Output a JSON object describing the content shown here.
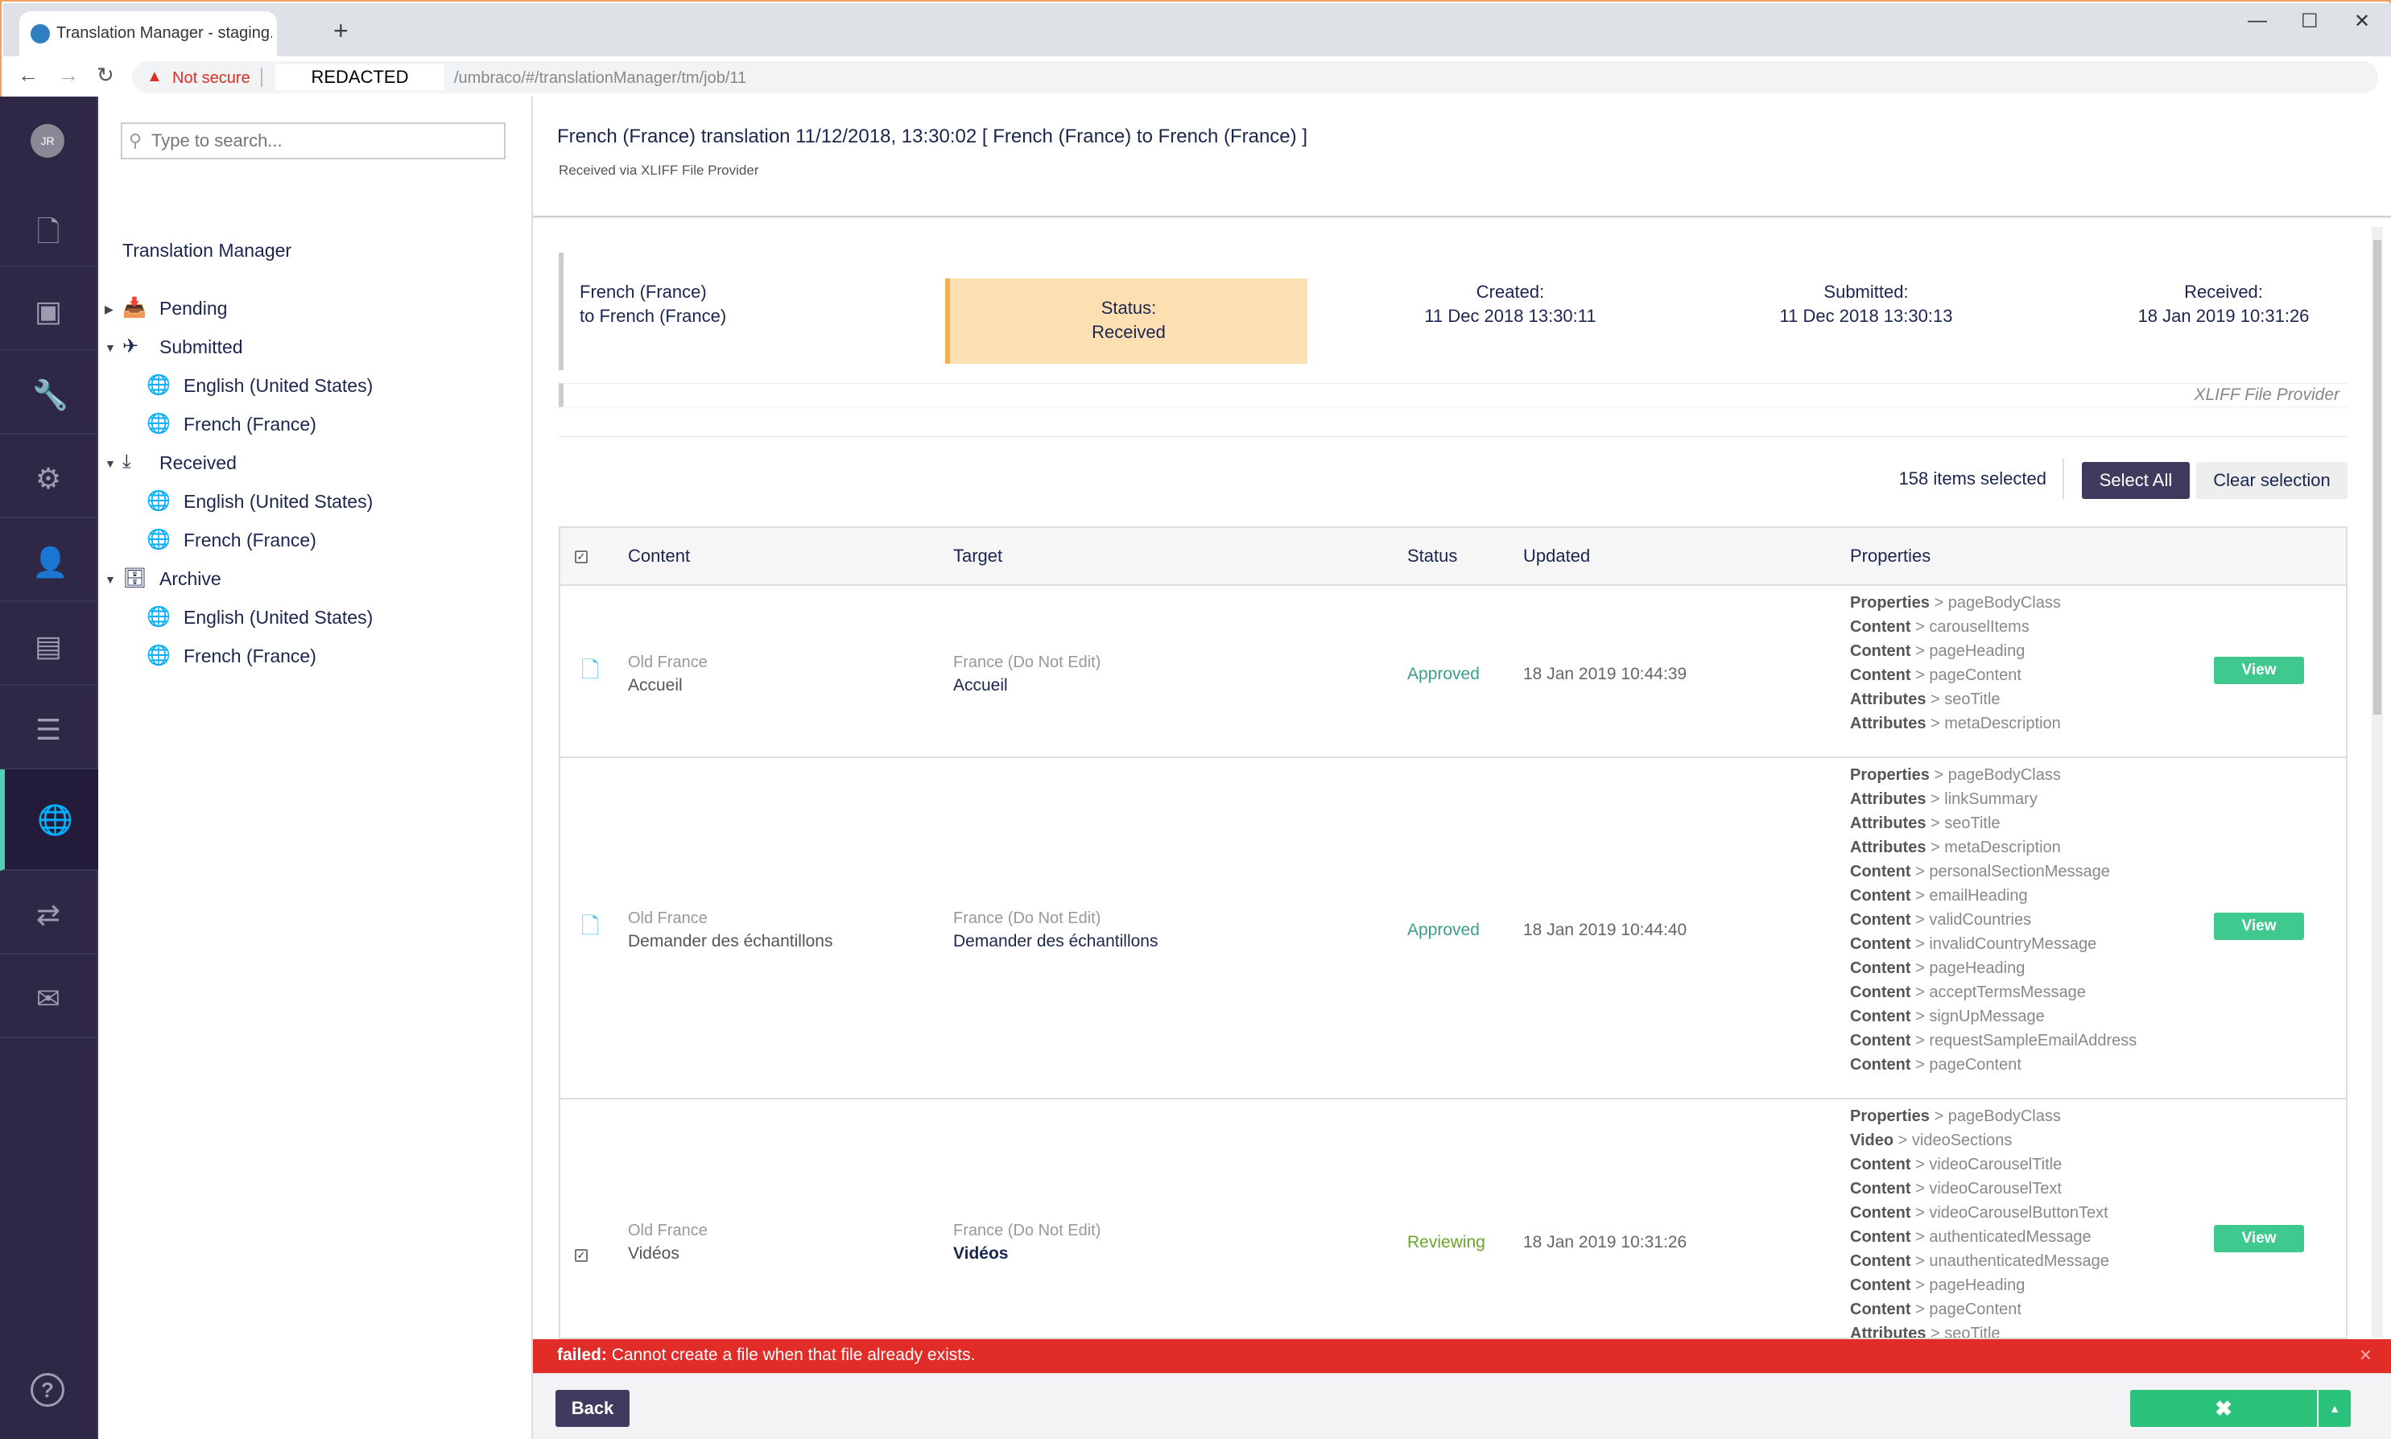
{
  "browser": {
    "tab_title": "Translation Manager - staging.ge",
    "new_tab": "+",
    "tab_close": "×",
    "minimize": "—",
    "maximize": "☐",
    "close": "✕",
    "not_secure": "Not secure",
    "redacted": "REDACTED",
    "url_path": "/umbraco/#/translationManager/tm/job/11"
  },
  "sidebar": {
    "avatar": "JR",
    "items": [
      "content-icon",
      "media-icon",
      "settings-wrench-icon",
      "settings-gear-icon",
      "members-icon",
      "forms-icon",
      "deploy-icon",
      "translation-globe-icon",
      "redirects-icon",
      "email-icon"
    ],
    "help": "?"
  },
  "tree": {
    "search_placeholder": "Type to search...",
    "title": "Translation Manager",
    "nodes": [
      {
        "label": "Pending"
      },
      {
        "label": "Submitted"
      },
      {
        "label": "English (United States)"
      },
      {
        "label": "French (France)"
      },
      {
        "label": "Received"
      },
      {
        "label": "English (United States)"
      },
      {
        "label": "French (France)"
      },
      {
        "label": "Archive"
      },
      {
        "label": "English (United States)"
      },
      {
        "label": "French (France)"
      }
    ]
  },
  "header": {
    "title": "French (France) translation 11/12/2018, 13:30:02 [ French (France) to French (France) ]",
    "subtitle": "Received via XLIFF File Provider"
  },
  "summary": {
    "from": "French (France)",
    "to_prefix": "to",
    "to": "French (France)",
    "status_label": "Status:",
    "status_value": "Received",
    "created_label": "Created:",
    "created_value": "11 Dec 2018 13:30:11",
    "submitted_label": "Submitted:",
    "submitted_value": "11 Dec 2018 13:30:13",
    "received_label": "Received:",
    "received_value": "18 Jan 2019 10:31:26",
    "provider": "XLIFF File Provider"
  },
  "selection": {
    "count_text": "158 items selected",
    "select_all": "Select All",
    "clear": "Clear selection"
  },
  "table": {
    "headers": {
      "content": "Content",
      "target": "Target",
      "status": "Status",
      "updated": "Updated",
      "properties": "Properties"
    },
    "view_label": "View",
    "rows": [
      {
        "source_site": "Old France",
        "source_name": "Accueil",
        "target_site": "France (Do Not Edit)",
        "target_name": "Accueil",
        "status": "Approved",
        "updated": "18 Jan 2019 10:44:39",
        "props": [
          [
            "Properties",
            "pageBodyClass"
          ],
          [
            "Content",
            "carouselItems"
          ],
          [
            "Content",
            "pageHeading"
          ],
          [
            "Content",
            "pageContent"
          ],
          [
            "Attributes",
            "seoTitle"
          ],
          [
            "Attributes",
            "metaDescription"
          ]
        ]
      },
      {
        "source_site": "Old France",
        "source_name": "Demander des échantillons",
        "target_site": "France (Do Not Edit)",
        "target_name": "Demander des échantillons",
        "status": "Approved",
        "updated": "18 Jan 2019 10:44:40",
        "props": [
          [
            "Properties",
            "pageBodyClass"
          ],
          [
            "Attributes",
            "linkSummary"
          ],
          [
            "Attributes",
            "seoTitle"
          ],
          [
            "Attributes",
            "metaDescription"
          ],
          [
            "Content",
            "personalSectionMessage"
          ],
          [
            "Content",
            "emailHeading"
          ],
          [
            "Content",
            "validCountries"
          ],
          [
            "Content",
            "invalidCountryMessage"
          ],
          [
            "Content",
            "pageHeading"
          ],
          [
            "Content",
            "acceptTermsMessage"
          ],
          [
            "Content",
            "signUpMessage"
          ],
          [
            "Content",
            "requestSampleEmailAddress"
          ],
          [
            "Content",
            "pageContent"
          ]
        ]
      },
      {
        "source_site": "Old France",
        "source_name": "Vidéos",
        "target_site": "France (Do Not Edit)",
        "target_name": "Vidéos",
        "status": "Reviewing",
        "updated": "18 Jan 2019 10:31:26",
        "props": [
          [
            "Properties",
            "pageBodyClass"
          ],
          [
            "Video",
            "videoSections"
          ],
          [
            "Content",
            "videoCarouselTitle"
          ],
          [
            "Content",
            "videoCarouselText"
          ],
          [
            "Content",
            "videoCarouselButtonText"
          ],
          [
            "Content",
            "authenticatedMessage"
          ],
          [
            "Content",
            "unauthenticatedMessage"
          ],
          [
            "Content",
            "pageHeading"
          ],
          [
            "Content",
            "pageContent"
          ],
          [
            "Attributes",
            "seoTitle"
          ]
        ]
      }
    ]
  },
  "error": {
    "prefix": "failed:",
    "message": "Cannot create a file when that file already exists.",
    "close": "×"
  },
  "footer": {
    "back": "Back",
    "save_icon": "✖",
    "caret": "▲"
  },
  "colors": {
    "sidebar": "#2e2745",
    "accent_green": "#2bc37c",
    "status_received": "#fde0b2",
    "error": "#e22c28",
    "approved": "#3a9e8a",
    "reviewing": "#6aa52a"
  }
}
